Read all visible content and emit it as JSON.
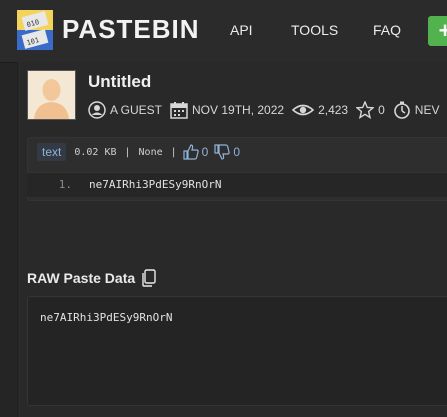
{
  "header": {
    "brand": "PASTEBIN",
    "nav": {
      "api": "API",
      "tools": "TOOLS",
      "faq": "FAQ"
    },
    "add_label": "+"
  },
  "paste": {
    "title": "Untitled",
    "author": "A GUEST",
    "date": "NOV 19TH, 2022",
    "views": "2,423",
    "stars": "0",
    "expiry_partial": "NEV"
  },
  "code_toolbar": {
    "syntax": "text",
    "size": "0.02 KB",
    "category": "None",
    "likes": "0",
    "dislikes": "0"
  },
  "code_lines": [
    {
      "number": "1.",
      "text": "ne7AIRhi3PdESy9RnOrN"
    }
  ],
  "raw": {
    "title": "RAW Paste Data",
    "text": "ne7AIRhi3PdESy9RnOrN"
  },
  "colors": {
    "background": "#252525",
    "header": "#2b2b2b",
    "accent_green": "#51b24e",
    "accent_blue": "#8fb3d9"
  },
  "icons": [
    "pastebin-logo",
    "user-icon",
    "calendar-icon",
    "eye-icon",
    "star-icon",
    "timer-icon",
    "thumbs-up-icon",
    "thumbs-down-icon",
    "copy-icon"
  ]
}
